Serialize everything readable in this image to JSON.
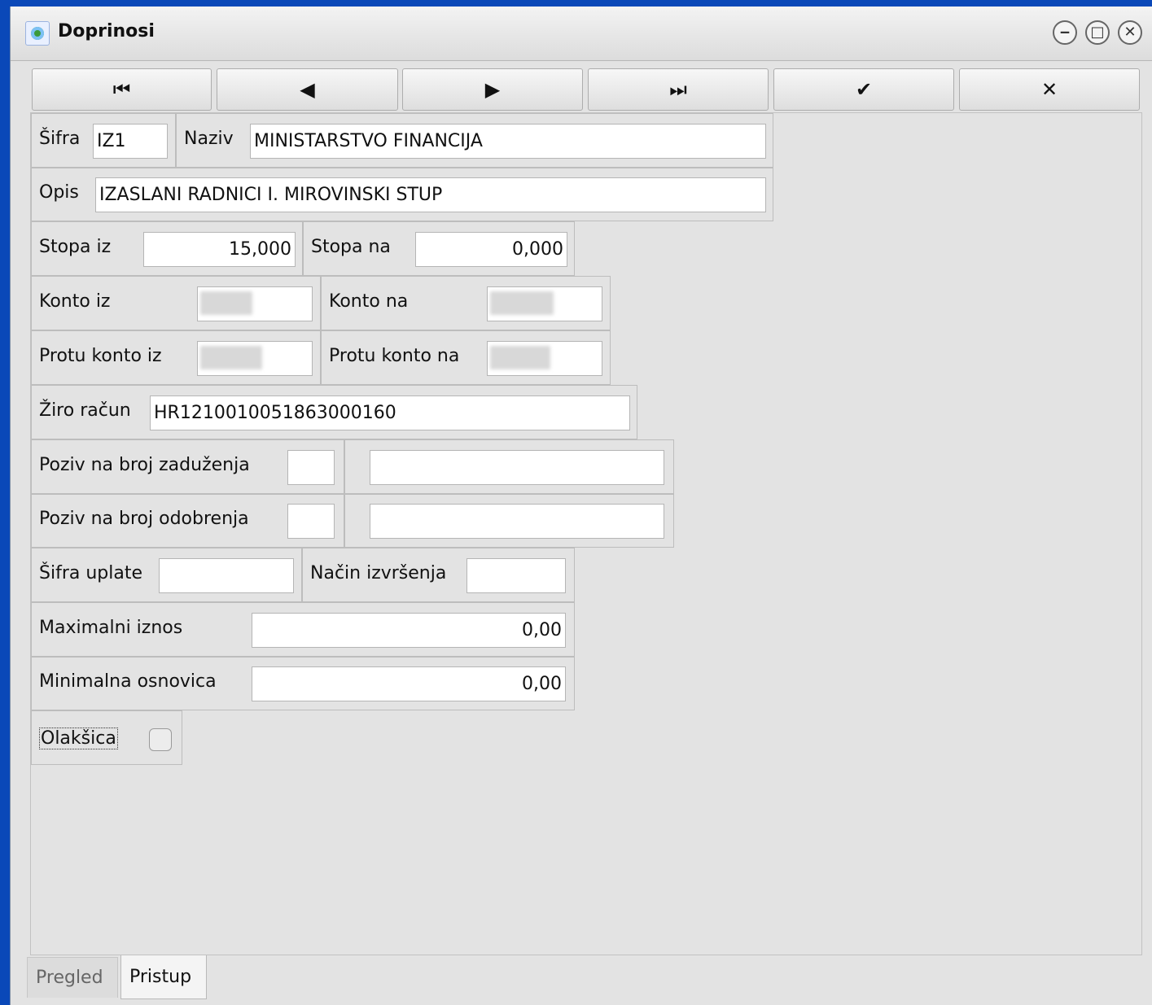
{
  "window": {
    "title": "Doprinosi"
  },
  "window_controls": {
    "minimize": "‒",
    "maximize": "□",
    "close": "✕"
  },
  "toolbar": {
    "first_icon": "⏮",
    "prev_icon": "◀",
    "next_icon": "▶",
    "last_icon": "⏭",
    "confirm_icon": "✔",
    "cancel_icon": "✕",
    "icons": [
      "first-record-icon",
      "previous-record-icon",
      "next-record-icon",
      "last-record-icon",
      "confirm-icon",
      "cancel-icon"
    ]
  },
  "form": {
    "sifra": {
      "label": "Šifra",
      "value": "IZ1"
    },
    "naziv": {
      "label": "Naziv",
      "value": "MINISTARSTVO FINANCIJA"
    },
    "opis": {
      "label": "Opis",
      "value": "IZASLANI RADNICI I. MIROVINSKI STUP"
    },
    "stopa_iz": {
      "label": "Stopa iz",
      "value": "15,000"
    },
    "stopa_na": {
      "label": "Stopa na",
      "value": "0,000"
    },
    "konto_iz": {
      "label": "Konto iz",
      "value": ""
    },
    "konto_na": {
      "label": "Konto na",
      "value": ""
    },
    "protu_konto_iz": {
      "label": "Protu konto iz",
      "value": ""
    },
    "protu_konto_na": {
      "label": "Protu konto na",
      "value": ""
    },
    "ziro_racun": {
      "label": "Žiro račun",
      "value": "HR1210010051863000160"
    },
    "poziv_zaduzenja": {
      "label": "Poziv na broj zaduženja",
      "model": "",
      "value": ""
    },
    "poziv_odobrenja": {
      "label": "Poziv na broj odobrenja",
      "model": "",
      "value": ""
    },
    "sifra_uplate": {
      "label": "Šifra uplate",
      "value": ""
    },
    "nacin_izvrsenja": {
      "label": "Način izvršenja",
      "value": ""
    },
    "maximalni_iznos": {
      "label": "Maximalni iznos",
      "value": "0,00"
    },
    "minimalna_osnovica": {
      "label": "Minimalna osnovica",
      "value": "0,00"
    },
    "olaksica": {
      "label": "Olakšica",
      "checked": false
    }
  },
  "tabs": [
    {
      "label": "Pregled",
      "active": false
    },
    {
      "label": "Pristup",
      "active": true
    }
  ],
  "colors": {
    "desktop": "#0a48b8",
    "window_bg": "#e3e3e3",
    "input_bg": "#ffffff"
  }
}
